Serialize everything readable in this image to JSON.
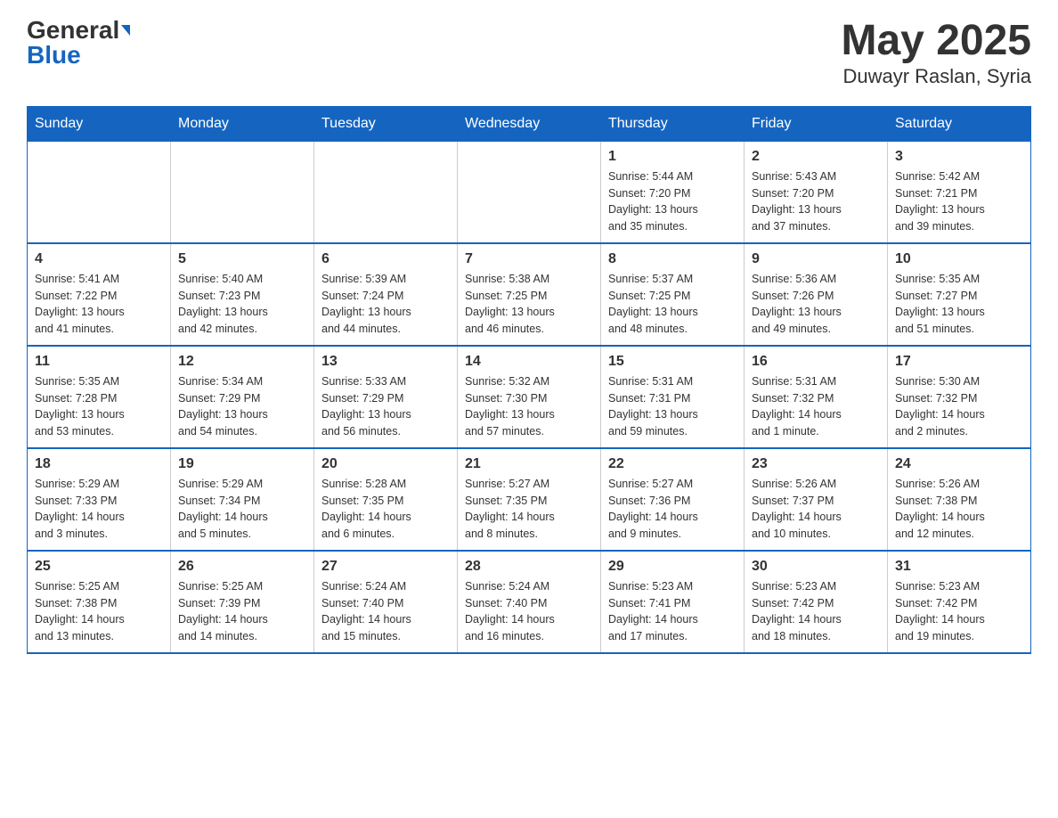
{
  "header": {
    "logo_general": "General",
    "logo_blue": "Blue",
    "month_year": "May 2025",
    "location": "Duwayr Raslan, Syria"
  },
  "days_of_week": [
    "Sunday",
    "Monday",
    "Tuesday",
    "Wednesday",
    "Thursday",
    "Friday",
    "Saturday"
  ],
  "weeks": [
    [
      {
        "day": "",
        "info": ""
      },
      {
        "day": "",
        "info": ""
      },
      {
        "day": "",
        "info": ""
      },
      {
        "day": "",
        "info": ""
      },
      {
        "day": "1",
        "info": "Sunrise: 5:44 AM\nSunset: 7:20 PM\nDaylight: 13 hours\nand 35 minutes."
      },
      {
        "day": "2",
        "info": "Sunrise: 5:43 AM\nSunset: 7:20 PM\nDaylight: 13 hours\nand 37 minutes."
      },
      {
        "day": "3",
        "info": "Sunrise: 5:42 AM\nSunset: 7:21 PM\nDaylight: 13 hours\nand 39 minutes."
      }
    ],
    [
      {
        "day": "4",
        "info": "Sunrise: 5:41 AM\nSunset: 7:22 PM\nDaylight: 13 hours\nand 41 minutes."
      },
      {
        "day": "5",
        "info": "Sunrise: 5:40 AM\nSunset: 7:23 PM\nDaylight: 13 hours\nand 42 minutes."
      },
      {
        "day": "6",
        "info": "Sunrise: 5:39 AM\nSunset: 7:24 PM\nDaylight: 13 hours\nand 44 minutes."
      },
      {
        "day": "7",
        "info": "Sunrise: 5:38 AM\nSunset: 7:25 PM\nDaylight: 13 hours\nand 46 minutes."
      },
      {
        "day": "8",
        "info": "Sunrise: 5:37 AM\nSunset: 7:25 PM\nDaylight: 13 hours\nand 48 minutes."
      },
      {
        "day": "9",
        "info": "Sunrise: 5:36 AM\nSunset: 7:26 PM\nDaylight: 13 hours\nand 49 minutes."
      },
      {
        "day": "10",
        "info": "Sunrise: 5:35 AM\nSunset: 7:27 PM\nDaylight: 13 hours\nand 51 minutes."
      }
    ],
    [
      {
        "day": "11",
        "info": "Sunrise: 5:35 AM\nSunset: 7:28 PM\nDaylight: 13 hours\nand 53 minutes."
      },
      {
        "day": "12",
        "info": "Sunrise: 5:34 AM\nSunset: 7:29 PM\nDaylight: 13 hours\nand 54 minutes."
      },
      {
        "day": "13",
        "info": "Sunrise: 5:33 AM\nSunset: 7:29 PM\nDaylight: 13 hours\nand 56 minutes."
      },
      {
        "day": "14",
        "info": "Sunrise: 5:32 AM\nSunset: 7:30 PM\nDaylight: 13 hours\nand 57 minutes."
      },
      {
        "day": "15",
        "info": "Sunrise: 5:31 AM\nSunset: 7:31 PM\nDaylight: 13 hours\nand 59 minutes."
      },
      {
        "day": "16",
        "info": "Sunrise: 5:31 AM\nSunset: 7:32 PM\nDaylight: 14 hours\nand 1 minute."
      },
      {
        "day": "17",
        "info": "Sunrise: 5:30 AM\nSunset: 7:32 PM\nDaylight: 14 hours\nand 2 minutes."
      }
    ],
    [
      {
        "day": "18",
        "info": "Sunrise: 5:29 AM\nSunset: 7:33 PM\nDaylight: 14 hours\nand 3 minutes."
      },
      {
        "day": "19",
        "info": "Sunrise: 5:29 AM\nSunset: 7:34 PM\nDaylight: 14 hours\nand 5 minutes."
      },
      {
        "day": "20",
        "info": "Sunrise: 5:28 AM\nSunset: 7:35 PM\nDaylight: 14 hours\nand 6 minutes."
      },
      {
        "day": "21",
        "info": "Sunrise: 5:27 AM\nSunset: 7:35 PM\nDaylight: 14 hours\nand 8 minutes."
      },
      {
        "day": "22",
        "info": "Sunrise: 5:27 AM\nSunset: 7:36 PM\nDaylight: 14 hours\nand 9 minutes."
      },
      {
        "day": "23",
        "info": "Sunrise: 5:26 AM\nSunset: 7:37 PM\nDaylight: 14 hours\nand 10 minutes."
      },
      {
        "day": "24",
        "info": "Sunrise: 5:26 AM\nSunset: 7:38 PM\nDaylight: 14 hours\nand 12 minutes."
      }
    ],
    [
      {
        "day": "25",
        "info": "Sunrise: 5:25 AM\nSunset: 7:38 PM\nDaylight: 14 hours\nand 13 minutes."
      },
      {
        "day": "26",
        "info": "Sunrise: 5:25 AM\nSunset: 7:39 PM\nDaylight: 14 hours\nand 14 minutes."
      },
      {
        "day": "27",
        "info": "Sunrise: 5:24 AM\nSunset: 7:40 PM\nDaylight: 14 hours\nand 15 minutes."
      },
      {
        "day": "28",
        "info": "Sunrise: 5:24 AM\nSunset: 7:40 PM\nDaylight: 14 hours\nand 16 minutes."
      },
      {
        "day": "29",
        "info": "Sunrise: 5:23 AM\nSunset: 7:41 PM\nDaylight: 14 hours\nand 17 minutes."
      },
      {
        "day": "30",
        "info": "Sunrise: 5:23 AM\nSunset: 7:42 PM\nDaylight: 14 hours\nand 18 minutes."
      },
      {
        "day": "31",
        "info": "Sunrise: 5:23 AM\nSunset: 7:42 PM\nDaylight: 14 hours\nand 19 minutes."
      }
    ]
  ]
}
